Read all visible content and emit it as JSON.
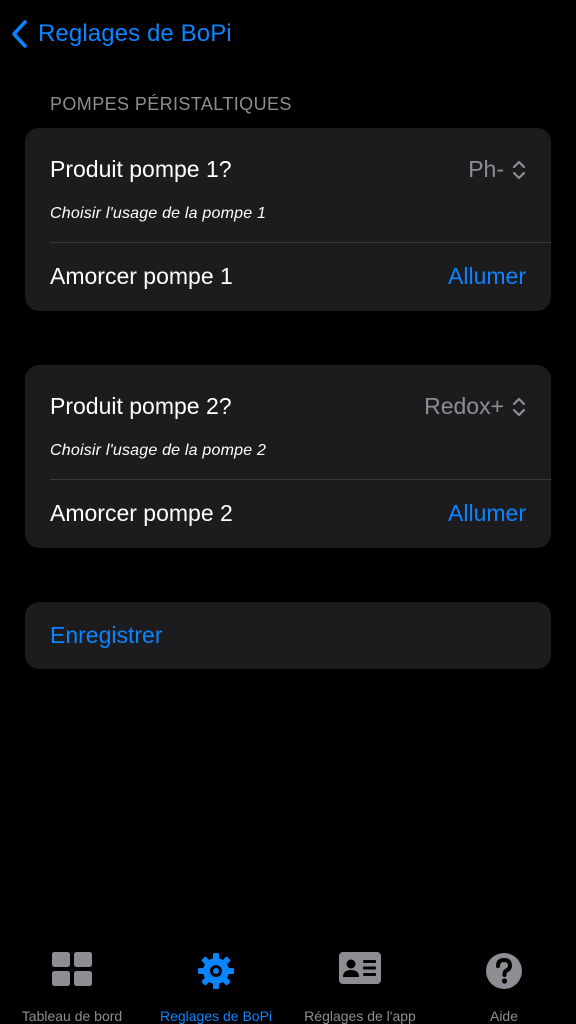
{
  "colors": {
    "background": "#000000",
    "card": "#1c1c1e",
    "accent": "#0a84ff",
    "secondary_text": "#8d8d93",
    "separator": "#38383a"
  },
  "nav": {
    "back_icon": "chevron-left-icon",
    "back_label": "Reglages de BoPi"
  },
  "section": {
    "header": "POMPES PÉRISTALTIQUES"
  },
  "pumps": [
    {
      "picker_label": "Produit pompe 1?",
      "picker_value": "Ph-",
      "picker_icon": "up-down-chevron-icon",
      "footer": "Choisir l'usage de la pompe 1",
      "action_label": "Amorcer pompe 1",
      "action_button": "Allumer"
    },
    {
      "picker_label": "Produit pompe 2?",
      "picker_value": "Redox+",
      "picker_icon": "up-down-chevron-icon",
      "footer": "Choisir l'usage de la pompe 2",
      "action_label": "Amorcer pompe 2",
      "action_button": "Allumer"
    }
  ],
  "save": {
    "label": "Enregistrer"
  },
  "tabbar": {
    "active_index": 1,
    "tabs": [
      {
        "label": "Tableau de bord",
        "icon": "dashboard-grid-icon"
      },
      {
        "label": "Reglages de BoPi",
        "icon": "gear-icon"
      },
      {
        "label": "Réglages de l'app",
        "icon": "contact-card-icon"
      },
      {
        "label": "Aide",
        "icon": "help-icon"
      }
    ]
  }
}
